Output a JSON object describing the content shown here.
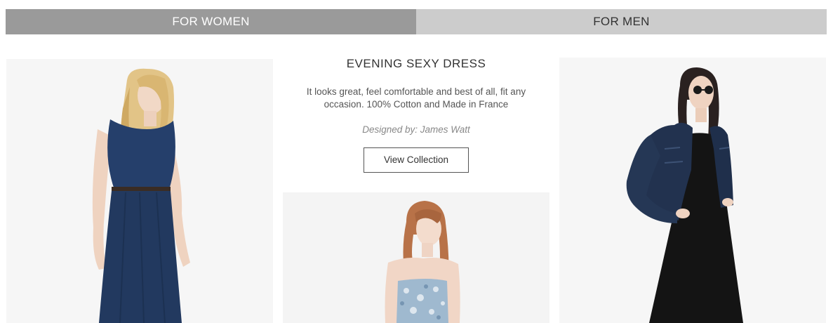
{
  "tabs": {
    "women_label": "FOR WOMEN",
    "men_label": "FOR MEN"
  },
  "collection": {
    "title": "EVENING SEXY DRESS",
    "description": "It looks great, feel comfortable and best of all, fit any occasion. 100% Cotton and Made in France",
    "designer": "Designed by: James Watt",
    "button_label": "View Collection"
  },
  "colors": {
    "tab_active_bg": "#9a9a9a",
    "tab_inactive_bg": "#cccccc",
    "denim_dress": "#253f6b",
    "black_dress": "#141414",
    "denim_jacket": "#22324f",
    "floral_dress": "#9fb9cf"
  },
  "images": [
    {
      "icon": "model-blue-dress-photo"
    },
    {
      "icon": "model-floral-bandeau-photo"
    },
    {
      "icon": "model-denim-jacket-photo"
    }
  ]
}
